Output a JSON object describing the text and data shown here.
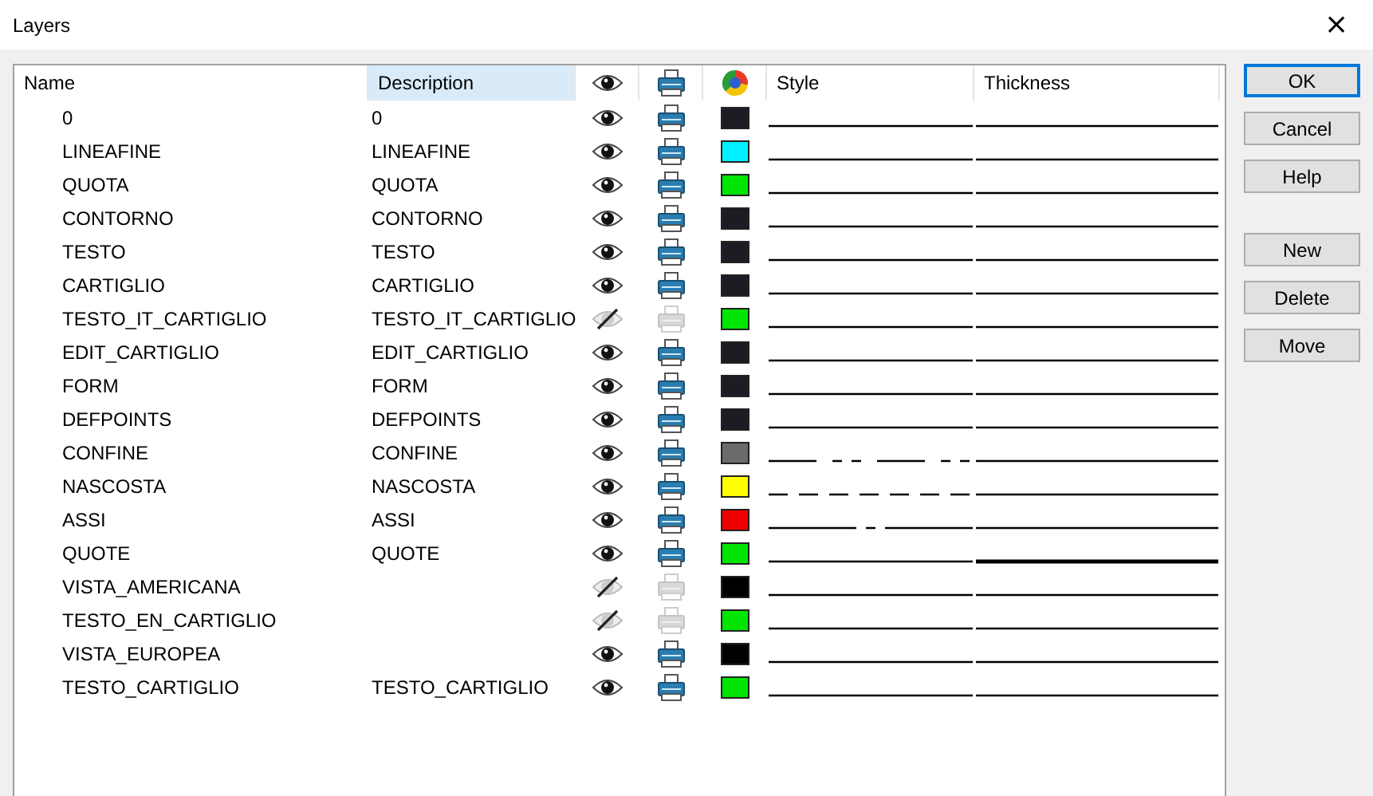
{
  "window": {
    "title": "Layers",
    "close": "×"
  },
  "columns": [
    {
      "label": "Name",
      "selected": false
    },
    {
      "label": "Description",
      "selected": true
    },
    {
      "label": "Style",
      "selected": false
    },
    {
      "label": "Thickness",
      "selected": false
    }
  ],
  "rows": [
    {
      "name": "0",
      "description": "0",
      "visible": true,
      "printable": true,
      "color": "#1c1c24",
      "style": {
        "kind": "continuous"
      },
      "thickness": {
        "kind": "thin"
      }
    },
    {
      "name": "LINEAFINE",
      "description": "LINEAFINE",
      "visible": true,
      "printable": true,
      "color": "#00f0ff",
      "style": {
        "kind": "continuous"
      },
      "thickness": {
        "kind": "thin"
      }
    },
    {
      "name": "QUOTA",
      "description": "QUOTA",
      "visible": true,
      "printable": true,
      "color": "#00e600",
      "style": {
        "kind": "continuous"
      },
      "thickness": {
        "kind": "thin"
      }
    },
    {
      "name": "CONTORNO",
      "description": "CONTORNO",
      "visible": true,
      "printable": true,
      "color": "#1c1c24",
      "style": {
        "kind": "continuous"
      },
      "thickness": {
        "kind": "thin"
      }
    },
    {
      "name": "TESTO",
      "description": "TESTO",
      "visible": true,
      "printable": true,
      "color": "#1c1c24",
      "style": {
        "kind": "continuous"
      },
      "thickness": {
        "kind": "thin"
      }
    },
    {
      "name": "CARTIGLIO",
      "description": "CARTIGLIO",
      "visible": true,
      "printable": true,
      "color": "#1c1c24",
      "style": {
        "kind": "continuous"
      },
      "thickness": {
        "kind": "thin"
      }
    },
    {
      "name": "TESTO_IT_CARTIGLIO",
      "description": "TESTO_IT_CARTIGLIO",
      "visible": false,
      "printable": false,
      "color": "#00e600",
      "style": {
        "kind": "continuous"
      },
      "thickness": {
        "kind": "thin"
      }
    },
    {
      "name": "EDIT_CARTIGLIO",
      "description": "EDIT_CARTIGLIO",
      "visible": true,
      "printable": true,
      "color": "#1c1c24",
      "style": {
        "kind": "continuous"
      },
      "thickness": {
        "kind": "thin"
      }
    },
    {
      "name": "FORM",
      "description": "FORM",
      "visible": true,
      "printable": true,
      "color": "#1c1c24",
      "style": {
        "kind": "continuous"
      },
      "thickness": {
        "kind": "thin"
      }
    },
    {
      "name": "DEFPOINTS",
      "description": "DEFPOINTS",
      "visible": true,
      "printable": true,
      "color": "#1c1c24",
      "style": {
        "kind": "continuous"
      },
      "thickness": {
        "kind": "thin"
      }
    },
    {
      "name": "CONFINE",
      "description": "CONFINE",
      "visible": true,
      "printable": true,
      "color": "#6b6b6b",
      "style": {
        "kind": "dashdot"
      },
      "thickness": {
        "kind": "thin"
      }
    },
    {
      "name": "NASCOSTA",
      "description": "NASCOSTA",
      "visible": true,
      "printable": true,
      "color": "#ffff00",
      "style": {
        "kind": "dashed"
      },
      "thickness": {
        "kind": "thin"
      }
    },
    {
      "name": "ASSI",
      "description": "ASSI",
      "visible": true,
      "printable": true,
      "color": "#ee0000",
      "style": {
        "kind": "center"
      },
      "thickness": {
        "kind": "thin"
      }
    },
    {
      "name": "QUOTE",
      "description": "QUOTE",
      "visible": true,
      "printable": true,
      "color": "#00e600",
      "style": {
        "kind": "continuous"
      },
      "thickness": {
        "kind": "thick"
      }
    },
    {
      "name": "VISTA_AMERICANA",
      "visible": false,
      "printable": false,
      "color": "#000000",
      "style": {
        "kind": "continuous"
      },
      "thickness": {
        "kind": "thin"
      }
    },
    {
      "name": "TESTO_EN_CARTIGLIO",
      "visible": false,
      "printable": false,
      "color": "#00e600",
      "style": {
        "kind": "continuous"
      },
      "thickness": {
        "kind": "thin"
      }
    },
    {
      "name": "VISTA_EUROPEA",
      "visible": true,
      "printable": true,
      "color": "#000000",
      "style": {
        "kind": "continuous"
      },
      "thickness": {
        "kind": "thin"
      }
    },
    {
      "name": "TESTO_CARTIGLIO",
      "description": "TESTO_CARTIGLIO",
      "visible": true,
      "printable": true,
      "color": "#00e600",
      "style": {
        "kind": "continuous"
      },
      "thickness": {
        "kind": "thin"
      }
    }
  ],
  "buttons": [
    {
      "label": "OK",
      "default": true,
      "kind": "dialog"
    },
    {
      "label": "Cancel",
      "default": false,
      "kind": "dialog"
    },
    {
      "label": "Help",
      "default": false,
      "kind": "dialog"
    },
    {
      "label": "New",
      "default": false,
      "kind": "edit"
    },
    {
      "label": "Delete",
      "default": false,
      "kind": "edit"
    },
    {
      "label": "Move",
      "default": false,
      "kind": "edit"
    }
  ]
}
